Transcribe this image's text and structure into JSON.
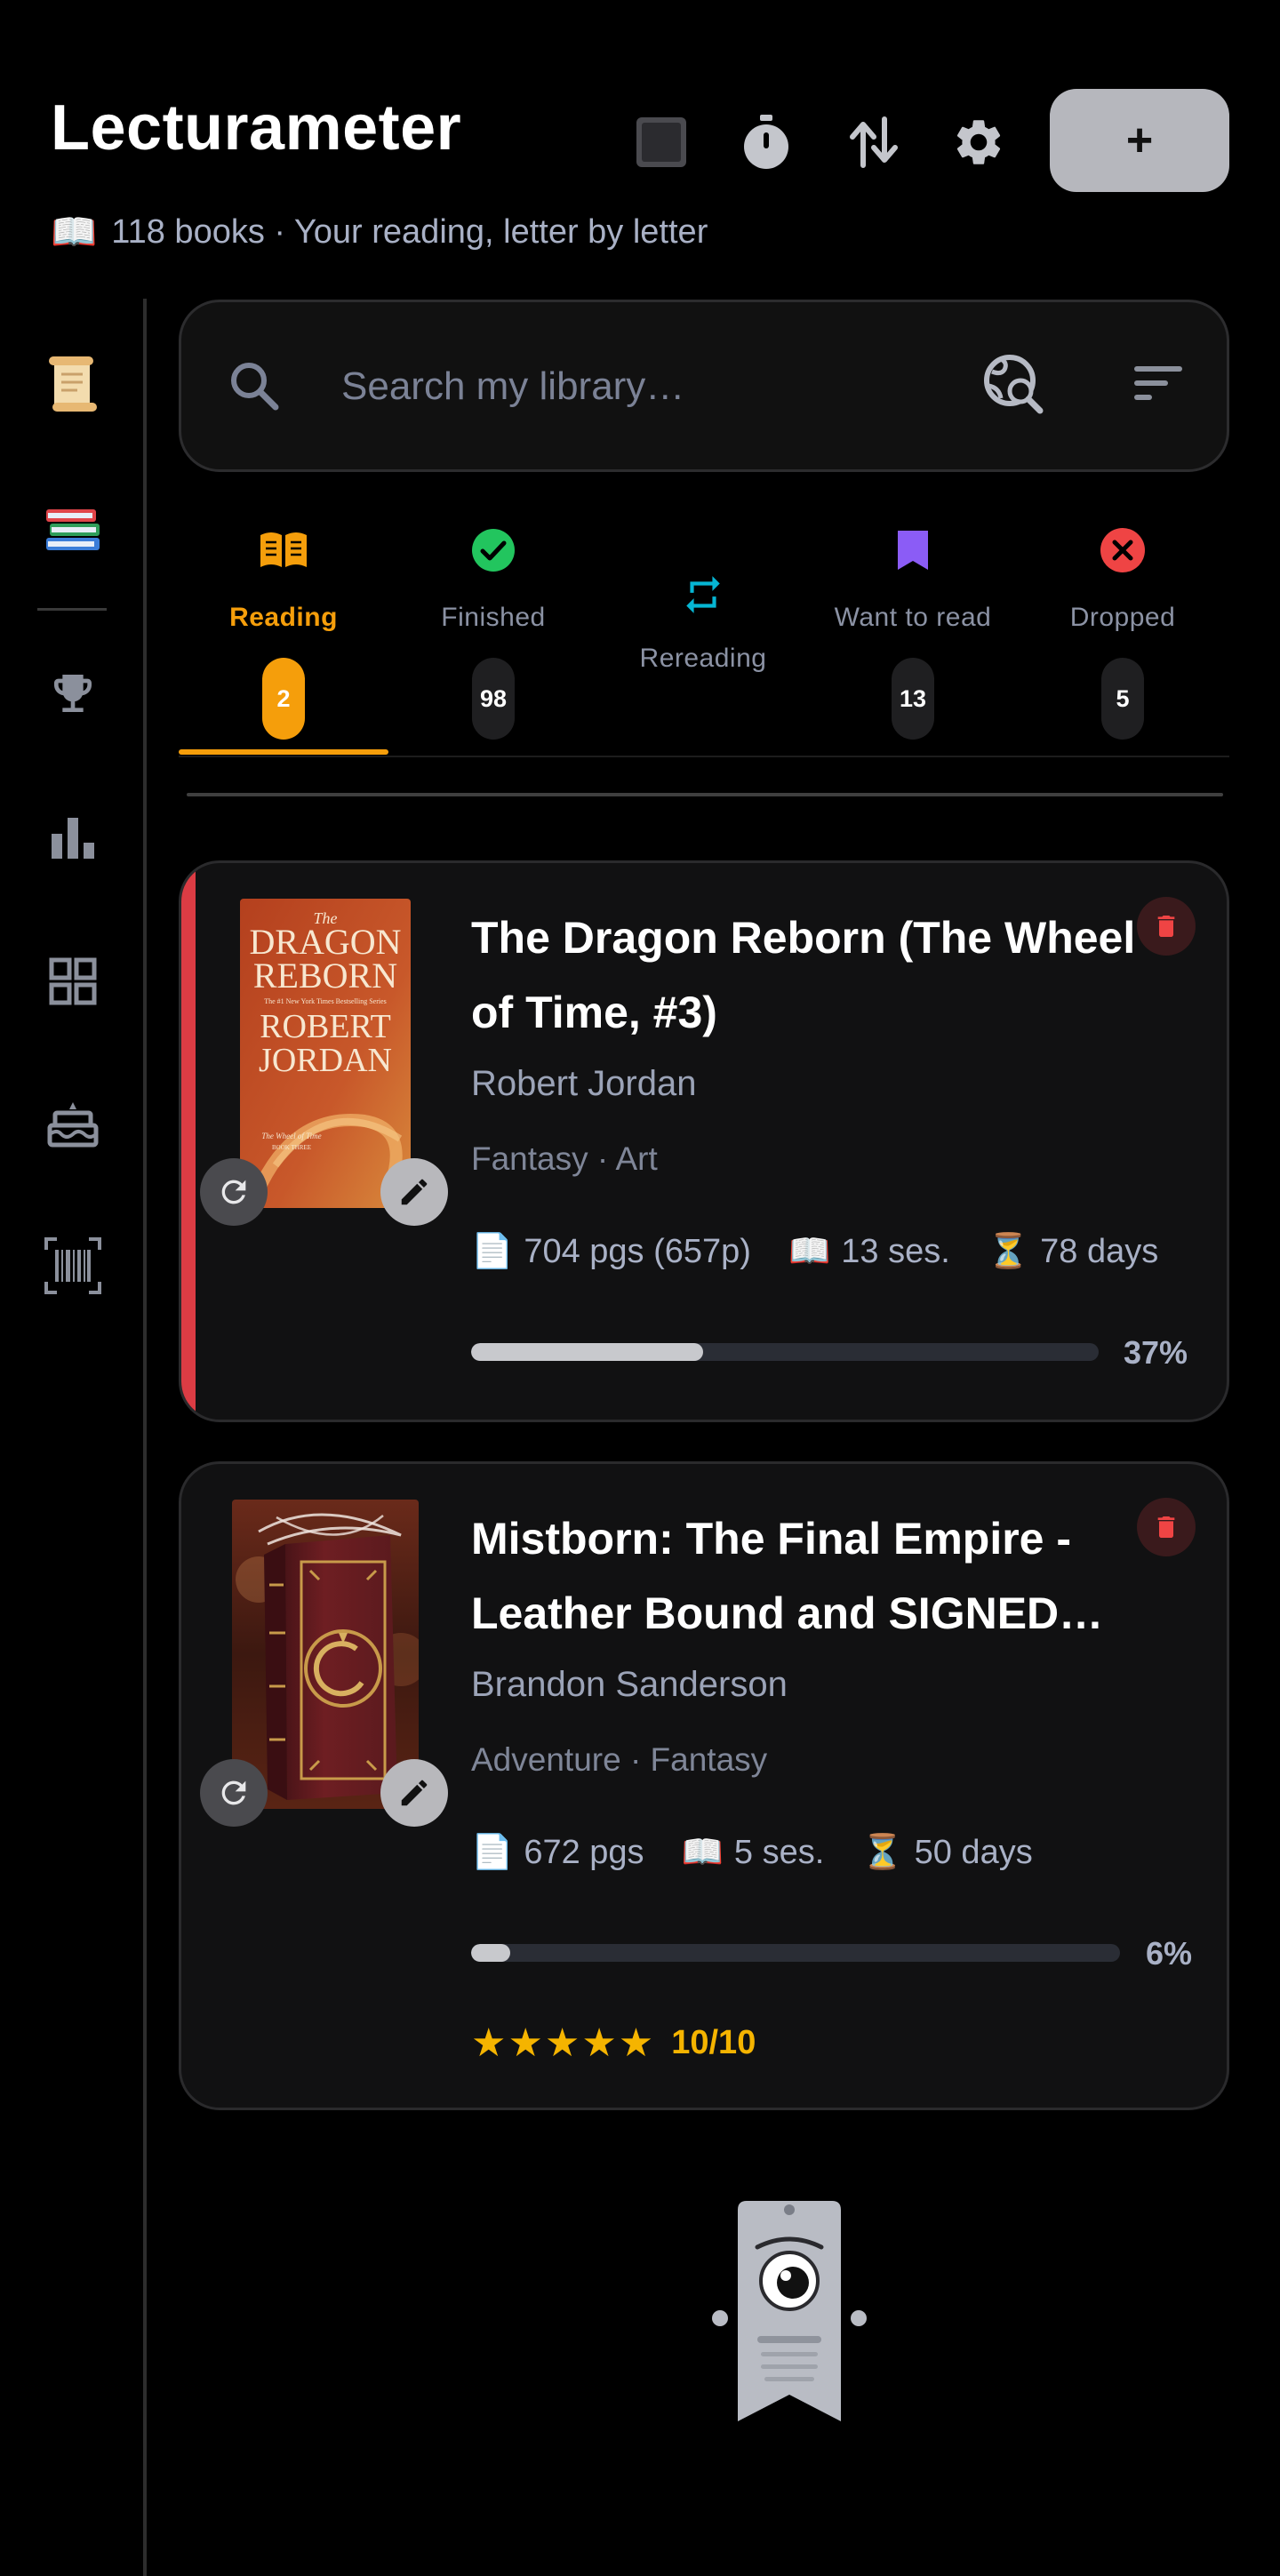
{
  "header": {
    "title": "Lecturameter",
    "subtitle": "118 books · Your reading, letter by letter",
    "subtitle_icon": "open-book-icon",
    "actions": [
      {
        "name": "stop-icon"
      },
      {
        "name": "stopwatch-icon"
      },
      {
        "name": "sort-arrows-icon"
      },
      {
        "name": "gear-icon"
      }
    ],
    "add_label": "+"
  },
  "sidebar": {
    "items": [
      {
        "name": "scroll-icon"
      },
      {
        "name": "books-icon"
      },
      {
        "name": "trophy-icon"
      },
      {
        "name": "bar-chart-icon"
      },
      {
        "name": "grid-icon"
      },
      {
        "name": "cake-icon"
      },
      {
        "name": "barcode-icon"
      }
    ]
  },
  "search": {
    "placeholder": "Search my library…",
    "value": ""
  },
  "tabs": [
    {
      "label": "Reading",
      "count": "2",
      "icon": "open-book-icon",
      "color": "#f59e0b",
      "active": true
    },
    {
      "label": "Finished",
      "count": "98",
      "icon": "check-circle-icon",
      "color": "#22c55e",
      "active": false
    },
    {
      "label": "Rereading",
      "count": "",
      "icon": "repeat-icon",
      "color": "#06b6d4",
      "active": false
    },
    {
      "label": "Want to read",
      "count": "13",
      "icon": "bookmark-icon",
      "color": "#8b5cf6",
      "active": false
    },
    {
      "label": "Dropped",
      "count": "5",
      "icon": "x-circle-icon",
      "color": "#ef4444",
      "active": false
    }
  ],
  "books": [
    {
      "title": "The Dragon Reborn (The Wheel of Time, #3)",
      "author": "Robert Jordan",
      "genres": "Fantasy · Art",
      "pages": "704 pgs (657p)",
      "sessions": "13 ses.",
      "days": "78 days",
      "progress_label": "37%",
      "progress": 0.37,
      "accent_color": "#dc3c44",
      "cover": {
        "line1": "The",
        "line2": "DRAGON",
        "line3": "REBORN",
        "tagline": "The #1 New York Times Bestselling Series",
        "author_line1": "ROBERT",
        "author_line2": "JORDAN",
        "series": "The Wheel of Time",
        "book_no": "BOOK THREE"
      }
    },
    {
      "title": "Mistborn: The Final Empire - Leather Bound and SIGNED…",
      "author": "Brandon Sanderson",
      "genres": "Adventure · Fantasy",
      "pages": "672 pgs",
      "sessions": "5 ses.",
      "days": "50 days",
      "progress_label": "6%",
      "progress": 0.06,
      "stars": "★★★★★",
      "rating": "10/10"
    }
  ]
}
